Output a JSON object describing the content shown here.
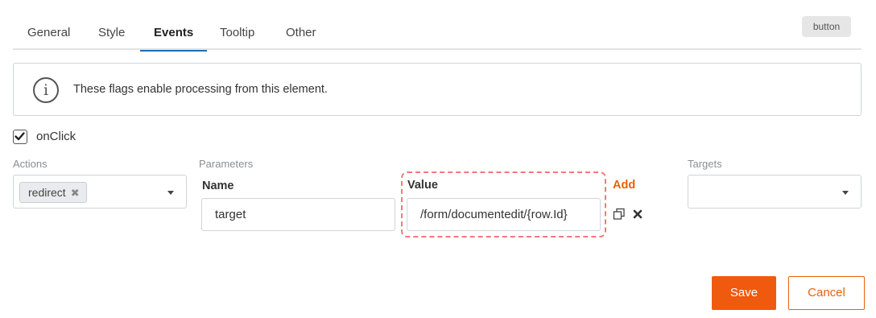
{
  "tabs": [
    {
      "label": "General"
    },
    {
      "label": "Style"
    },
    {
      "label": "Events"
    },
    {
      "label": "Tooltip"
    },
    {
      "label": "Other"
    }
  ],
  "active_tab": "Events",
  "element_type_badge": "button",
  "info": {
    "icon": "info-circle-icon",
    "text": "These flags enable processing from this element."
  },
  "onclick": {
    "label": "onClick",
    "checked": true
  },
  "actions": {
    "label": "Actions",
    "selected_chip": "redirect"
  },
  "parameters": {
    "label": "Parameters",
    "name_header": "Name",
    "value_header": "Value",
    "add_label": "Add",
    "rows": [
      {
        "name": "target",
        "value": "/form/documentedit/{row.Id}"
      }
    ]
  },
  "targets": {
    "label": "Targets",
    "selected": ""
  },
  "buttons": {
    "save": "Save",
    "cancel": "Cancel"
  },
  "colors": {
    "accent": "#f05a0f",
    "active_tab_underline": "#1f6fb5",
    "highlight_dashed": "#f07a7a"
  }
}
